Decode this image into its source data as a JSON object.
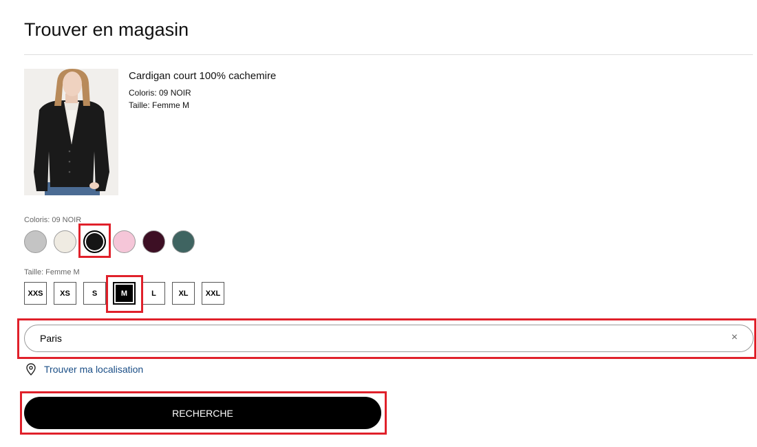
{
  "page": {
    "title": "Trouver en magasin"
  },
  "product": {
    "name": "Cardigan court 100% cachemire",
    "colour_line": "Coloris: 09 NOIR",
    "size_line": "Taille: Femme M",
    "image": "woman-in-black-cardigan-photo"
  },
  "colour_selector": {
    "label": "Coloris: 09 NOIR",
    "swatches": [
      {
        "color": "#c4c4c4",
        "selected": false
      },
      {
        "color": "#efebe2",
        "selected": false
      },
      {
        "color": "#151515",
        "selected": true
      },
      {
        "color": "#f5c6d8",
        "selected": false
      },
      {
        "color": "#3d0f24",
        "selected": false
      },
      {
        "color": "#3f6461",
        "selected": false
      }
    ]
  },
  "size_selector": {
    "label": "Taille: Femme M",
    "sizes": [
      {
        "label": "XXS",
        "selected": false
      },
      {
        "label": "XS",
        "selected": false
      },
      {
        "label": "S",
        "selected": false
      },
      {
        "label": "M",
        "selected": true
      },
      {
        "label": "L",
        "selected": false
      },
      {
        "label": "XL",
        "selected": false
      },
      {
        "label": "XXL",
        "selected": false
      }
    ]
  },
  "search": {
    "value": "Paris",
    "clear_icon": "×"
  },
  "location_link": {
    "label": "Trouver ma localisation",
    "icon": "location-pin-icon"
  },
  "submit": {
    "label": "RECHERCHE"
  },
  "colors": {
    "highlight": "#e0202a",
    "link": "#1a4e86",
    "button_bg": "#000000"
  }
}
